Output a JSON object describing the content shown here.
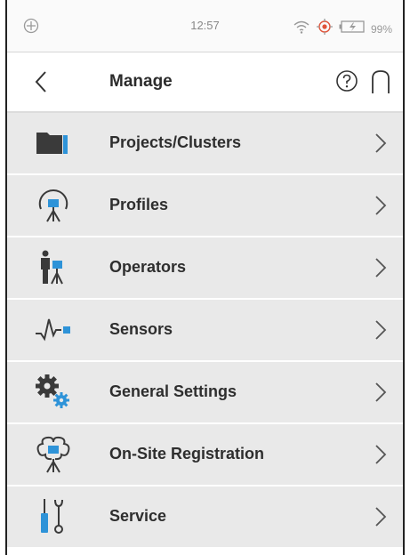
{
  "status_bar": {
    "time": "12:57",
    "battery": "99%",
    "icons": [
      "gps-icon",
      "wifi-icon",
      "location-icon",
      "battery-icon"
    ]
  },
  "header": {
    "title": "Manage",
    "icons": [
      "back-icon",
      "help-icon",
      "home-icon"
    ]
  },
  "menu": {
    "items": [
      {
        "label": "Projects/Clusters",
        "icon": "folder-icon"
      },
      {
        "label": "Profiles",
        "icon": "profile-icon"
      },
      {
        "label": "Operators",
        "icon": "operator-icon"
      },
      {
        "label": "Sensors",
        "icon": "sensor-icon"
      },
      {
        "label": "General Settings",
        "icon": "gears-icon"
      },
      {
        "label": "On-Site Registration",
        "icon": "registration-icon"
      },
      {
        "label": "Service",
        "icon": "service-icon"
      }
    ]
  },
  "colors": {
    "accent": "#2e93d8",
    "icon_dark": "#3a3a3a",
    "row_bg": "#e9e9e9",
    "text": "#2e2e2e"
  }
}
